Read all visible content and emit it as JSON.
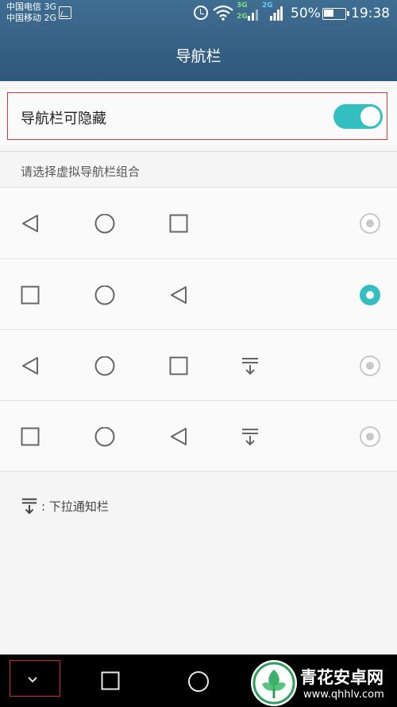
{
  "status_bar": {
    "carrier_1": "中国电信 3G",
    "carrier_2": "中国移动 2G",
    "net_badge_a": "3G",
    "net_badge_b": "2G",
    "net_badge_c": "2G",
    "battery": "50%",
    "time": "19:38"
  },
  "header": {
    "title": "导航栏"
  },
  "toggle": {
    "label": "导航栏可隐藏",
    "state": "on"
  },
  "section_label": "请选择虚拟导航栏组合",
  "combos": [
    {
      "icons": [
        "back",
        "home",
        "recent"
      ],
      "selected": false
    },
    {
      "icons": [
        "recent",
        "home",
        "back"
      ],
      "selected": true
    },
    {
      "icons": [
        "back",
        "home",
        "recent",
        "notification-pulldown"
      ],
      "selected": false
    },
    {
      "icons": [
        "recent",
        "home",
        "back",
        "notification-pulldown"
      ],
      "selected": false
    }
  ],
  "legend": {
    "icon": "notification-pulldown",
    "text": ": 下拉通知栏"
  },
  "watermark": {
    "title": "青花安卓网",
    "url": "www.qhhlv.com"
  },
  "colors": {
    "accent": "#33bfbf",
    "header_bg": "#355f82",
    "highlight": "#c94040"
  }
}
